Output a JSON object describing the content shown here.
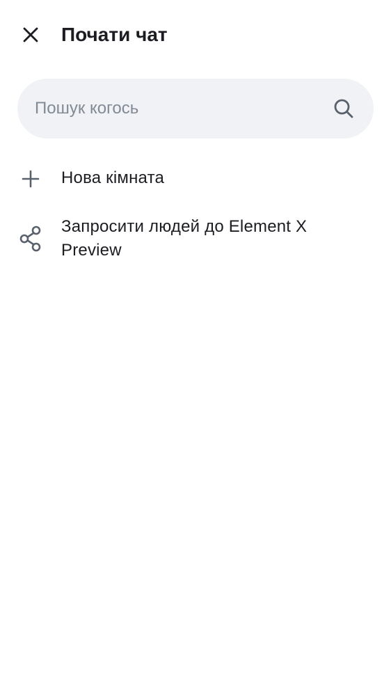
{
  "header": {
    "title": "Почати чат",
    "close_icon": "close-icon"
  },
  "search": {
    "placeholder": "Пошук когось",
    "value": "",
    "icon": "search-icon"
  },
  "actions": [
    {
      "label": "Нова кімната",
      "icon": "plus-icon"
    },
    {
      "label": "Запросити людей до Element X Preview",
      "icon": "share-icon"
    }
  ],
  "colors": {
    "text": "#1b1d22",
    "icon": "#59616d",
    "search_background": "#f0f2f5",
    "placeholder": "#818a95",
    "background": "#ffffff"
  }
}
